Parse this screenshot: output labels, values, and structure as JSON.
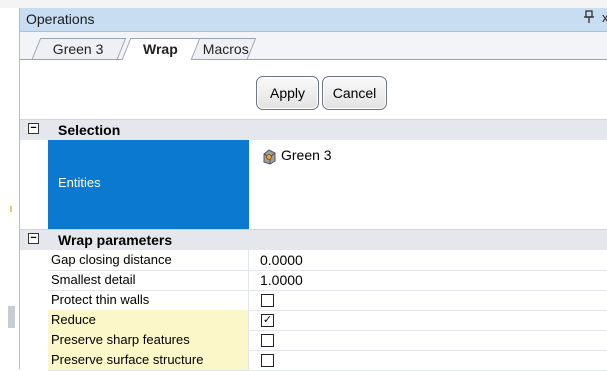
{
  "panel": {
    "title": "Operations",
    "pin_glyph": "↕",
    "close_glyph": "x"
  },
  "tabs": [
    {
      "label": "Green 3",
      "active": false
    },
    {
      "label": "Wrap",
      "active": true
    },
    {
      "label": "Macros",
      "active": false
    }
  ],
  "buttons": {
    "apply": "Apply",
    "cancel": "Cancel"
  },
  "sections": {
    "selection": {
      "label": "Selection",
      "toggle": "−",
      "entities_label": "Entities",
      "entities_value": "Green 3",
      "entity_icon": "mesh-object-icon"
    },
    "wrap_parameters": {
      "label": "Wrap parameters",
      "toggle": "−",
      "rows": [
        {
          "label": "Gap closing distance",
          "value": "0.0000"
        },
        {
          "label": "Smallest detail",
          "value": "1.0000"
        },
        {
          "label": "Protect thin walls",
          "checked": false
        },
        {
          "label": "Reduce",
          "checked": true,
          "check_glyph": "✓"
        },
        {
          "label": "Preserve sharp features",
          "checked": false
        },
        {
          "label": "Preserve surface structure",
          "checked": false
        }
      ]
    }
  },
  "colors": {
    "selected_cell": "#0b79d0",
    "highlight_row": "#fbf7c8",
    "titlebar": "#c9ddf2"
  }
}
